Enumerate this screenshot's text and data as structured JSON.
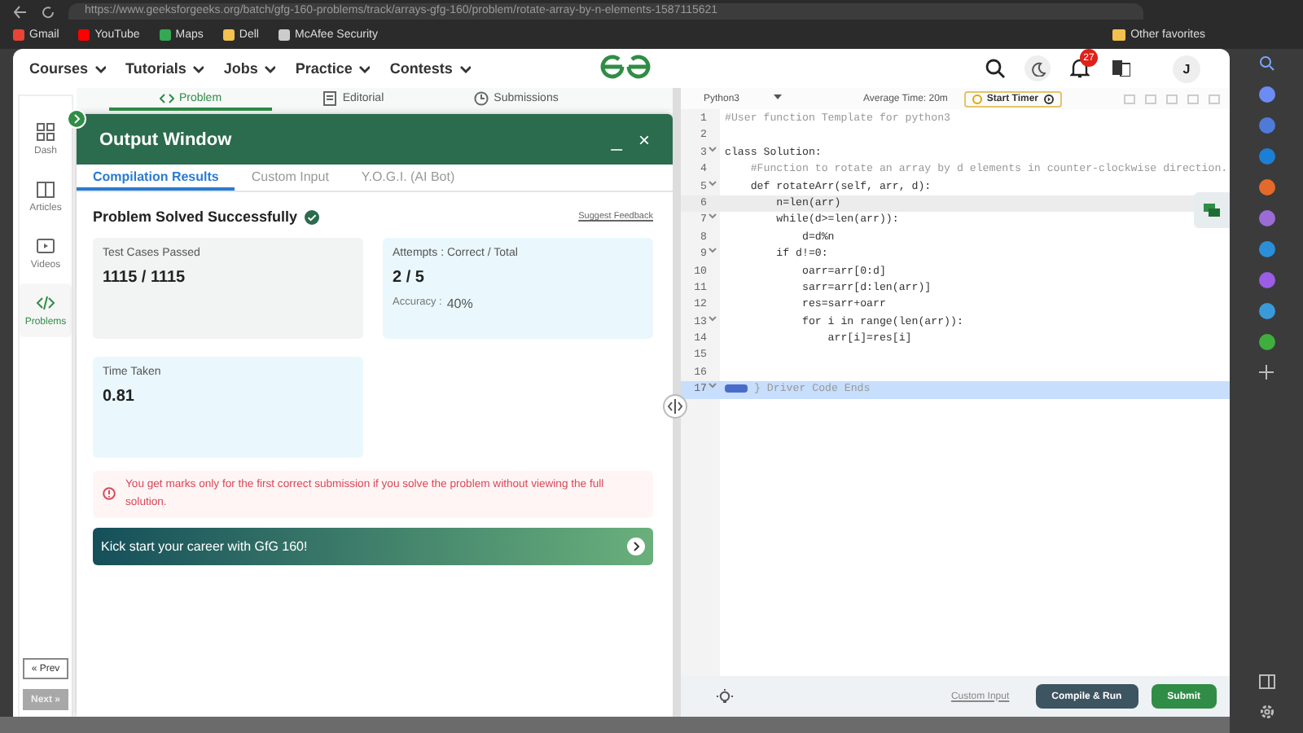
{
  "browser": {
    "url": "https://www.geeksforgeeks.org/batch/gfg-160-problems/track/arrays-gfg-160/problem/rotate-array-by-n-elements-1587115621",
    "bookmarks": [
      {
        "label": "Gmail",
        "color": "#ea4335"
      },
      {
        "label": "YouTube",
        "color": "#ff0000"
      },
      {
        "label": "Maps",
        "color": "#34a853"
      },
      {
        "label": "Dell",
        "color": "#f2c14e"
      },
      {
        "label": "McAfee Security",
        "color": "#cccccc"
      }
    ],
    "other_favorites": "Other favorites"
  },
  "nav": {
    "menus": [
      "Courses",
      "Tutorials",
      "Jobs",
      "Practice",
      "Contests"
    ],
    "notification_count": "27",
    "avatar_letter": "J"
  },
  "sidebar": {
    "items": [
      {
        "label": "Dash",
        "selected": false
      },
      {
        "label": "Articles",
        "selected": false
      },
      {
        "label": "Videos",
        "selected": false
      },
      {
        "label": "Problems",
        "selected": true
      }
    ],
    "prev": {
      "label": "« Prev",
      "disabled": false
    },
    "next": {
      "label": "Next »",
      "disabled": true
    }
  },
  "problem_tabs": [
    {
      "label": "Problem",
      "selected": true
    },
    {
      "label": "Editorial",
      "selected": false
    },
    {
      "label": "Submissions",
      "selected": false
    }
  ],
  "output_window": {
    "title": "Output Window",
    "minimize": "_",
    "close": "×",
    "tabs": [
      {
        "label": "Compilation Results",
        "selected": true
      },
      {
        "label": "Custom Input",
        "selected": false
      },
      {
        "label": "Y.O.G.I. (AI Bot)",
        "selected": false
      }
    ],
    "status": "Problem Solved Successfully",
    "suggest_feedback": "Suggest Feedback",
    "cards": [
      {
        "label": "Test Cases Passed",
        "value": "1115 / 1115",
        "color": "#f1f4f3"
      },
      {
        "label": "Attempts : Correct / Total",
        "value": "2 / 5",
        "sub_label": "Accuracy :",
        "sub_value": "40%",
        "color": "#eaf8fd"
      },
      {
        "label": "Time Taken",
        "value": "0.81",
        "color": "#eaf8fd"
      }
    ],
    "note": "You get marks only for the first correct submission if you solve the problem without viewing the full solution.",
    "banner": "Kick start your career with GfG 160!"
  },
  "editor": {
    "language": "Python3",
    "average_time": "Average Time: 20m",
    "timer": "Start Timer",
    "lines": [
      {
        "number": "1",
        "code": "#User function Template for python3",
        "kind": "comment",
        "foldable": false,
        "active": false,
        "selected": false
      },
      {
        "number": "2",
        "kind": "code",
        "foldable": false,
        "active": false,
        "selected": false
      },
      {
        "number": "3",
        "code": "class Solution:",
        "kind": "code",
        "foldable": true,
        "active": false,
        "selected": false
      },
      {
        "number": "4",
        "code": "    #Function to rotate an array by d elements in counter-clockwise direction.",
        "kind": "comment",
        "foldable": false,
        "active": false,
        "selected": false
      },
      {
        "number": "5",
        "code": "    def rotateArr(self, arr, d):",
        "kind": "code",
        "foldable": true,
        "active": false,
        "selected": false
      },
      {
        "number": "6",
        "code": "        n=len(arr)",
        "kind": "code",
        "foldable": false,
        "active": true,
        "selected": false
      },
      {
        "number": "7",
        "code": "        while(d>=len(arr)):",
        "kind": "code",
        "foldable": true,
        "active": false,
        "selected": false
      },
      {
        "number": "8",
        "code": "            d=d%n",
        "kind": "code",
        "foldable": false,
        "active": false,
        "selected": false
      },
      {
        "number": "9",
        "code": "        if d!=0:",
        "kind": "code",
        "foldable": true,
        "active": false,
        "selected": false
      },
      {
        "number": "10",
        "code": "            oarr=arr[0:d]",
        "kind": "code",
        "foldable": false,
        "active": false,
        "selected": false
      },
      {
        "number": "11",
        "code": "            sarr=arr[d:len(arr)]",
        "kind": "code",
        "foldable": false,
        "active": false,
        "selected": false
      },
      {
        "number": "12",
        "code": "            res=sarr+oarr",
        "kind": "code",
        "foldable": false,
        "active": false,
        "selected": false
      },
      {
        "number": "13",
        "code": "            for i in range(len(arr)):",
        "kind": "code",
        "foldable": true,
        "active": false,
        "selected": false
      },
      {
        "number": "14",
        "code": "                arr[i]=res[i]",
        "kind": "code",
        "foldable": false,
        "active": false,
        "selected": false
      },
      {
        "number": "15",
        "kind": "code",
        "foldable": false,
        "active": false,
        "selected": false
      },
      {
        "number": "16",
        "kind": "code",
        "foldable": false,
        "active": false,
        "selected": false
      },
      {
        "number": "17",
        "code": "} Driver Code Ends",
        "kind": "folded",
        "foldable": true,
        "active": false,
        "selected": true
      }
    ],
    "custom_input": "Custom Input",
    "compile": "Compile & Run",
    "submit": "Submit"
  }
}
